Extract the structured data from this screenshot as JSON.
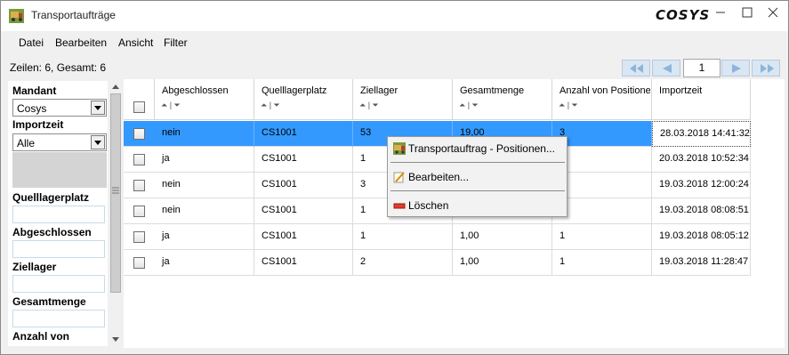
{
  "window": {
    "title": "Transportaufträge",
    "brand": "COSYS"
  },
  "menu": {
    "items": [
      "Datei",
      "Bearbeiten",
      "Ansicht",
      "Filter"
    ]
  },
  "status": {
    "rows_info": "Zeilen: 6, Gesamt: 6"
  },
  "pager": {
    "page": "1"
  },
  "filters": {
    "mandant_label": "Mandant",
    "mandant_value": "Cosys",
    "importzeit_label": "Importzeit",
    "importzeit_value": "Alle",
    "quelllagerplatz_label": "Quelllagerplatz",
    "abgeschlossen_label": "Abgeschlossen",
    "ziellager_label": "Ziellager",
    "gesamtmenge_label": "Gesamtmenge",
    "anzahl_label": "Anzahl von"
  },
  "table": {
    "columns": [
      "Abgeschlossen",
      "Quelllagerplatz",
      "Ziellager",
      "Gesamtmenge",
      "Anzahl von Positionen",
      "Importzeit"
    ],
    "rows": [
      [
        "nein",
        "CS1001",
        "53",
        "19,00",
        "3",
        "28.03.2018 14:41:32"
      ],
      [
        "ja",
        "CS1001",
        "1",
        "",
        "",
        "20.03.2018 10:52:34"
      ],
      [
        "nein",
        "CS1001",
        "3",
        "",
        "",
        "19.03.2018 12:00:24"
      ],
      [
        "nein",
        "CS1001",
        "1",
        "",
        "",
        "19.03.2018 08:08:51"
      ],
      [
        "ja",
        "CS1001",
        "1",
        "1,00",
        "1",
        "19.03.2018 08:05:12"
      ],
      [
        "ja",
        "CS1001",
        "2",
        "1,00",
        "1",
        "19.03.2018 11:28:47"
      ]
    ]
  },
  "context_menu": {
    "positionen": "Transportauftrag - Positionen...",
    "bearbeiten": "Bearbeiten...",
    "loeschen": "Löschen"
  }
}
